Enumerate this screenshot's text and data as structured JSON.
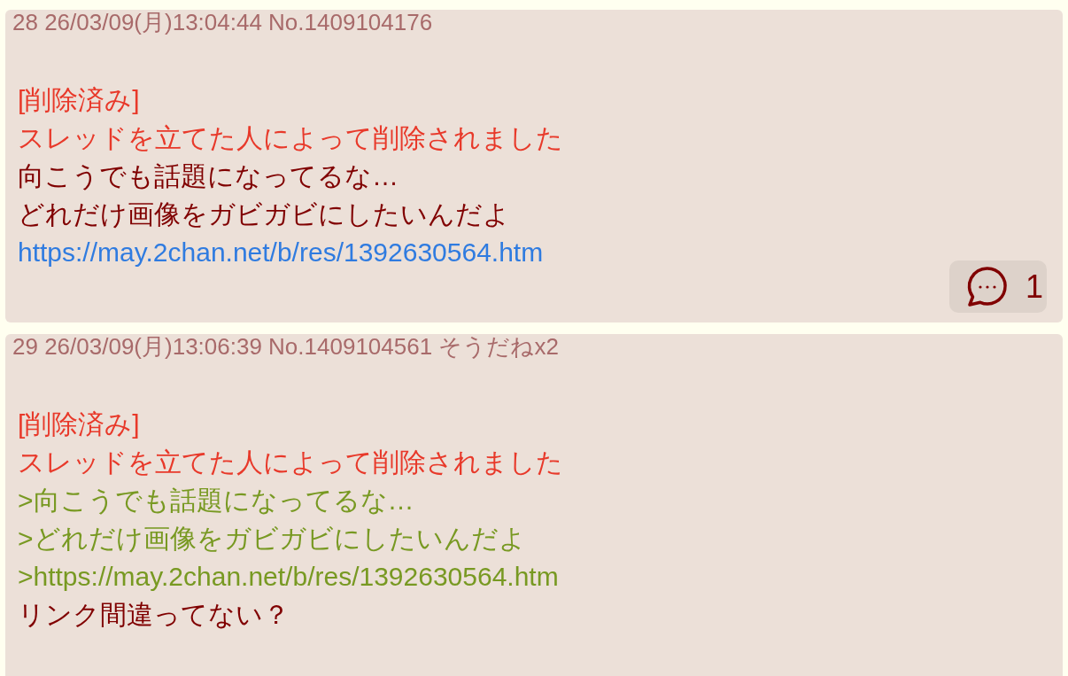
{
  "posts": [
    {
      "header": "28 26/03/09(月)13:04:44 No.1409104176",
      "lines": [
        {
          "kind": "deleted",
          "text": "[削除済み]"
        },
        {
          "kind": "deleted",
          "text": "スレッドを立てた人によって削除されました"
        },
        {
          "kind": "normal",
          "text": "向こうでも話題になってるな…"
        },
        {
          "kind": "normal",
          "text": "どれだけ画像をガビガビにしたいんだよ"
        },
        {
          "kind": "link",
          "text": "https://may.2chan.net/b/res/1392630564.htm"
        }
      ],
      "replies": "1"
    },
    {
      "header": "29 26/03/09(月)13:06:39 No.1409104561 そうだねx2",
      "lines": [
        {
          "kind": "deleted",
          "text": "[削除済み]"
        },
        {
          "kind": "deleted",
          "text": "スレッドを立てた人によって削除されました"
        },
        {
          "kind": "quote",
          "text": ">向こうでも話題になってるな…"
        },
        {
          "kind": "quote",
          "text": ">どれだけ画像をガビガビにしたいんだよ"
        },
        {
          "kind": "quote",
          "text": ">https://may.2chan.net/b/res/1392630564.htm"
        },
        {
          "kind": "normal",
          "text": "リンク間違ってない？"
        }
      ]
    }
  ]
}
